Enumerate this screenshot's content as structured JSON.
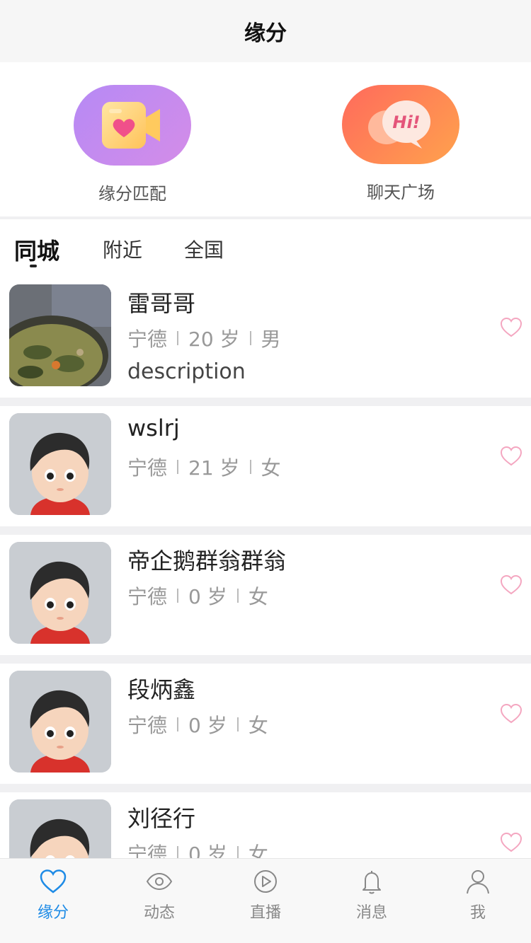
{
  "header": {
    "title": "缘分"
  },
  "features": {
    "match": {
      "label": "缘分匹配",
      "icon": "video-heart-icon"
    },
    "chat": {
      "label": "聊天广场",
      "icon": "hi-chat-bubble-icon",
      "bubble_text": "Hi!"
    }
  },
  "tabs": [
    {
      "label": "同城",
      "active": true
    },
    {
      "label": "附近",
      "active": false
    },
    {
      "label": "全国",
      "active": false
    }
  ],
  "users": [
    {
      "name": "雷哥哥",
      "city": "宁德",
      "age": "20 岁",
      "gender": "男",
      "description": "description",
      "avatar": "food-photo"
    },
    {
      "name": "wslrj",
      "city": "宁德",
      "age": "21 岁",
      "gender": "女",
      "description": "",
      "avatar": "default-avatar"
    },
    {
      "name": "帝企鹅群翁群翁",
      "city": "宁德",
      "age": "0 岁",
      "gender": "女",
      "description": "",
      "avatar": "default-avatar"
    },
    {
      "name": "段炳鑫",
      "city": "宁德",
      "age": "0 岁",
      "gender": "女",
      "description": "",
      "avatar": "default-avatar"
    },
    {
      "name": "刘径行",
      "city": "宁德",
      "age": "0 岁",
      "gender": "女",
      "description": "",
      "avatar": "default-avatar"
    }
  ],
  "nav": [
    {
      "label": "缘分",
      "icon": "heart-icon",
      "active": true
    },
    {
      "label": "动态",
      "icon": "eye-icon",
      "active": false
    },
    {
      "label": "直播",
      "icon": "play-icon",
      "active": false
    },
    {
      "label": "消息",
      "icon": "bell-icon",
      "active": false
    },
    {
      "label": "我",
      "icon": "user-icon",
      "active": false
    }
  ],
  "colors": {
    "accent": "#1e8be6",
    "like_heart": "#f4a6c0",
    "match_gradient": [
      "#b68af5",
      "#d48ce8"
    ],
    "chat_gradient": [
      "#ff6a5c",
      "#ffa24d"
    ]
  }
}
